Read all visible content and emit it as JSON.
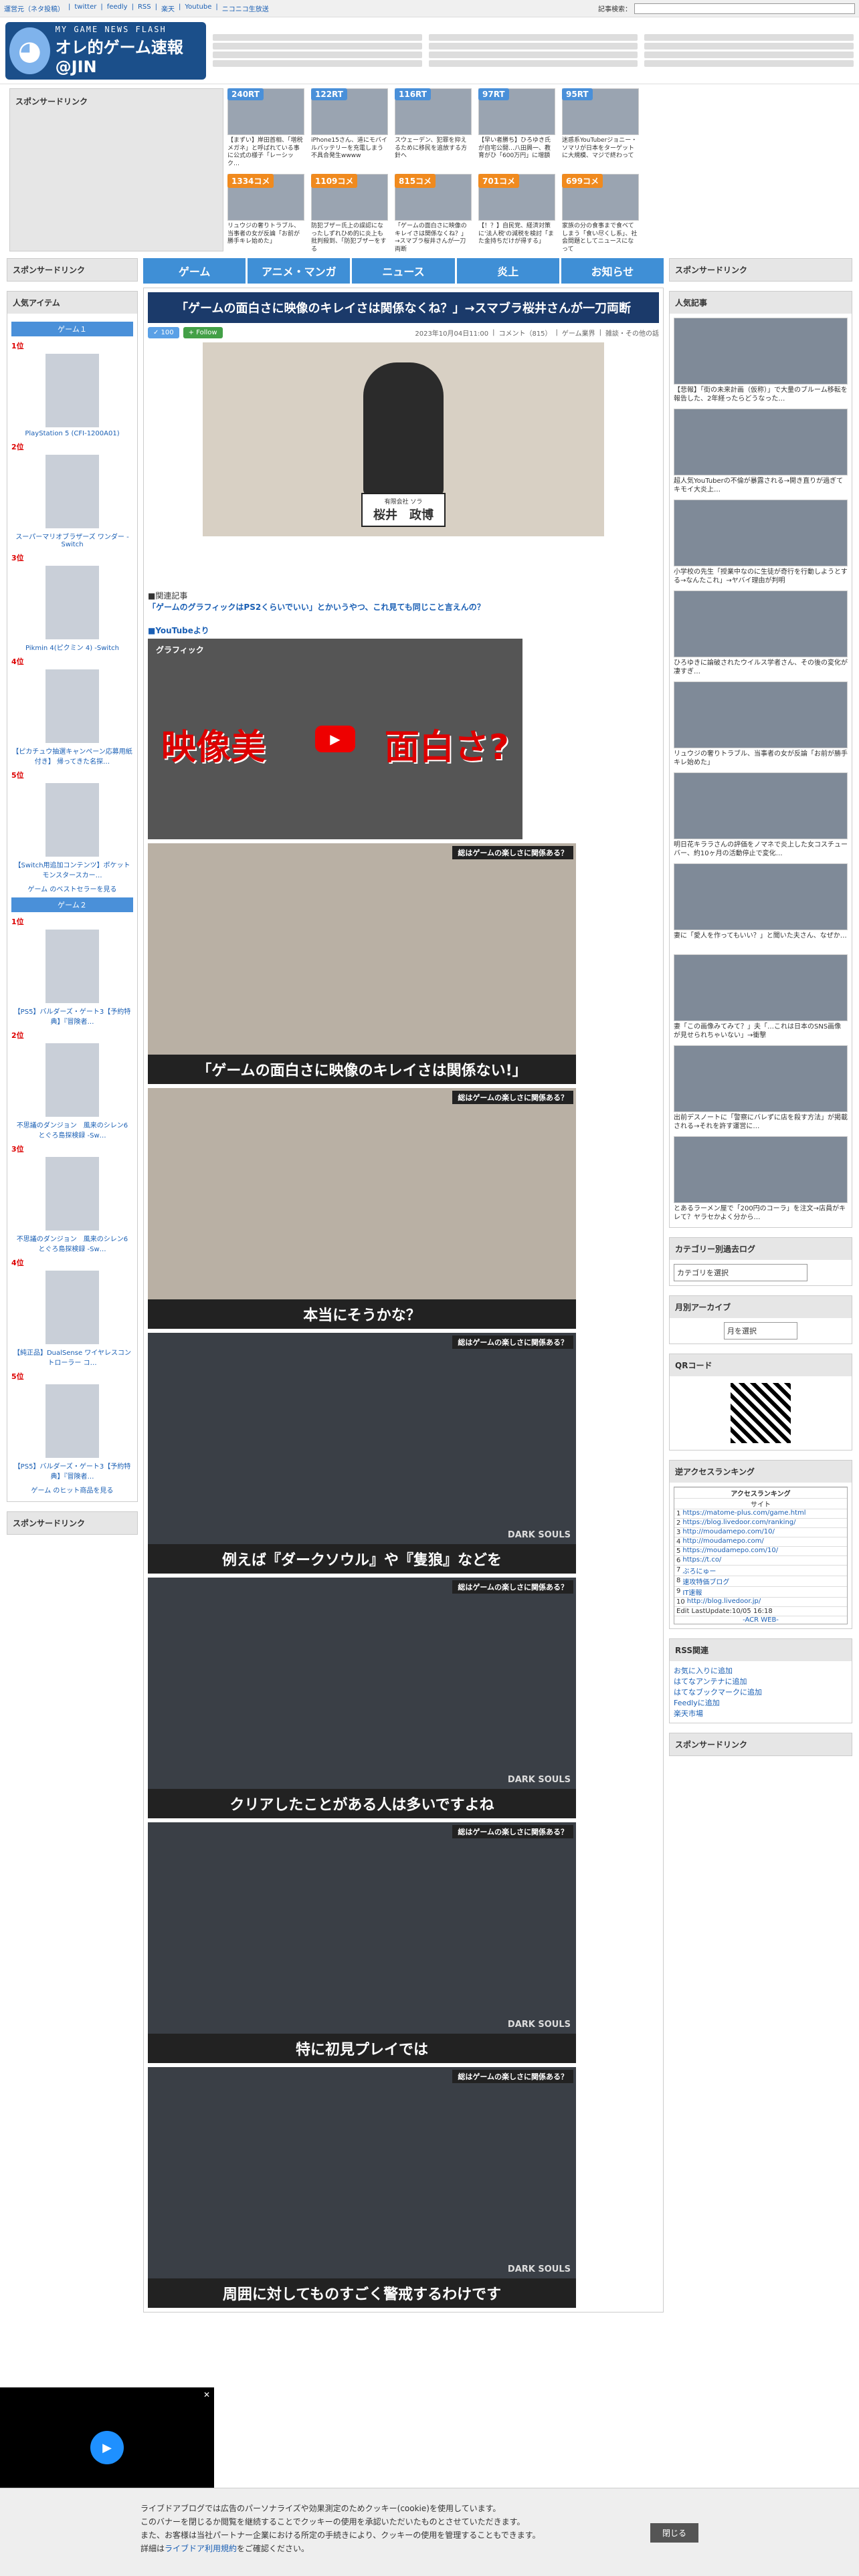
{
  "topbar": {
    "links": [
      "運営元（ネタ投稿）",
      "twitter",
      "feedly",
      "RSS",
      "楽天",
      "Youtube",
      "ニコニコ生放送"
    ],
    "search_label": "記事検索："
  },
  "logo": {
    "title_small": "MY GAME NEWS FLASH",
    "title_large": "オレ的ゲーム速報@JIN"
  },
  "sponsor_label": "スポンサードリンク",
  "top_thumbs_row1": [
    {
      "badge": "240RT",
      "caption": "【まずい】岸田首相、「増税メガネ」と呼ばれている事に公式の様子「レーシック…"
    },
    {
      "badge": "122RT",
      "caption": "iPhone15さん、道にモバイルバッテリーを充電しまう不具合発生wwww"
    },
    {
      "badge": "116RT",
      "caption": "スウェーデン、犯罪を抑えるために移民を追放する方針へ"
    },
    {
      "badge": "97RT",
      "caption": "【早い者勝ち】ひろゆき氏が自宅公開…八田興一、教育がひ「600万円」に増額"
    },
    {
      "badge": "95RT",
      "caption": "迷惑系YouTuberジョニー・ソマリが日本をターゲットに大規模、マジで終わって"
    }
  ],
  "top_thumbs_row2": [
    {
      "badge": "1334コメ",
      "caption": "リュウジの奢りトラブル、当事者の女が反論「お前が勝手キレ始めた」"
    },
    {
      "badge": "1109コメ",
      "caption": "防犯ブザー氏上の誤認になったしずれひめ的に炎上も批判殺到、「防犯ブザーをする"
    },
    {
      "badge": "815コメ",
      "caption": "「ゲームの面白さに映像のキレイさは関係なくね？」→スマブラ桜井さんが一刀両断"
    },
    {
      "badge": "701コメ",
      "caption": "【！？】自民党、経済対策に'法人税'の減税を検討「また金持ちだけが得する」"
    },
    {
      "badge": "699コメ",
      "caption": "家族の分の食事まで食べてしまう「食い尽くし系」、社会問題としてニュースになって"
    }
  ],
  "nav": [
    "ゲーム",
    "アニメ・マンガ",
    "ニュース",
    "炎上",
    "お知らせ"
  ],
  "left": {
    "popular_label": "人気アイテム",
    "game1_label": "ゲーム１",
    "game1_items": [
      {
        "rank": "1位",
        "title": "PlayStation 5 (CFI-1200A01)"
      },
      {
        "rank": "2位",
        "title": "スーパーマリオブラザーズ ワンダー -Switch"
      },
      {
        "rank": "3位",
        "title": "Pikmin 4(ピクミン 4) -Switch"
      },
      {
        "rank": "4位",
        "title": "【ピカチュウ抽選キャンペーン応募用紙付き】 帰ってきた名探…"
      },
      {
        "rank": "5位",
        "title": "【Switch用追加コンテンツ】ポケットモンスタースカー…"
      }
    ],
    "game1_more": "ゲーム のベストセラーを見る",
    "game2_label": "ゲーム２",
    "game2_items": [
      {
        "rank": "1位",
        "title": "【PS5】バルダーズ・ゲート3【予約特典】『冒険者…"
      },
      {
        "rank": "2位",
        "title": "不思議のダンジョン　風来のシレン6　とぐろ島探検録 -Sw…"
      },
      {
        "rank": "3位",
        "title": "不思議のダンジョン　風来のシレン6　とぐろ島探検録 -Sw…"
      },
      {
        "rank": "4位",
        "title": "【純正品】DualSense ワイヤレスコントローラー コ…"
      },
      {
        "rank": "5位",
        "title": "【PS5】バルダーズ・ゲート3【予約特典】『冒険者…"
      }
    ],
    "game2_more": "ゲーム のヒット商品を見る"
  },
  "article": {
    "title": "「ゲームの面白さに映像のキレイさは関係なくね？」→スマブラ桜井さんが一刀両断",
    "date": "2023年10月04日11:00",
    "comment": "コメント（815）",
    "category": "ゲーム業界",
    "category2": "雑談・その他の話",
    "name_card_small": "有限会社 ソラ",
    "name_card": "桜井　政博",
    "related_label": "■関連記事",
    "related_link": "「ゲームのグラフィックはPS2くらいでいい」とかいうやつ、これ見ても同じこと言えんの？",
    "yt_label": "■YouTubeより",
    "yt_title": "グラフィック",
    "yt_big_left": "映像美",
    "yt_big_right": "面白さ?",
    "slide_tag": "総はゲームの楽しさに関係ある？",
    "slides": [
      {
        "caption": "「ゲームの面白さに映像のキレイさは関係ない!」"
      },
      {
        "caption": "本当にそうかな？"
      },
      {
        "caption": "例えば『ダークソウル』や『隻狼』などを"
      },
      {
        "caption": "クリアしたことがある人は多いですよね"
      },
      {
        "caption": "特に初見プレイでは"
      },
      {
        "caption": "周囲に対してものすごく警戒するわけです"
      }
    ],
    "dark_souls_logo": "DARK SOULS"
  },
  "right": {
    "popular_articles": "人気記事",
    "articles": [
      "【悲報】「街の未来計画（仮称）」で大量のブルーム移転を報告した、2年経ったらどうなった…",
      "超人気YouTuberの不倫が暴露される→開き直りが過ぎてキモイ大炎上…",
      "小学校の先生「授業中なのに生徒が奇行を行動しようとする→なんたこれ」→ヤバイ理由が判明",
      "ひろゆきに論破されたウイルス学者さん、その後の変化が凄すぎ…",
      "リュウジの奢りトラブル、当事者の女が反論「お前が勝手キレ始めた」",
      "明日花キララさんの評価をノマネで炎上した女コスチューバー、約10ヶ月の活動停止で変化…",
      "妻に「愛人を作ってもいい？」と聞いた夫さん、なぜか…",
      "妻「この画像みてみて？」夫「…これは日本のSNS画像が見せられちゃいない」→衝撃",
      "出前デスノートに「警察にバレずに店を殺す方法」が掲載される→それを許す運営に…",
      "とあるラーメン屋で「200円のコーラ」を注文→店員がキレて？ヤラセかよく分から…"
    ],
    "category_label": "カテゴリー別過去ログ",
    "category_select": "カテゴリを選択",
    "archive_label": "月別アーカイブ",
    "archive_select": "月を選択",
    "qr_label": "QRコード",
    "access_label": "逆アクセスランキング",
    "access_header": "アクセスランキング",
    "access_subheader": "サイト",
    "access_rows": [
      {
        "n": "1",
        "site": "https://matome-plus.com/game.html"
      },
      {
        "n": "2",
        "site": "https://blog.livedoor.com/ranking/"
      },
      {
        "n": "3",
        "site": "http://moudamepo.com/10/"
      },
      {
        "n": "4",
        "site": "http://moudamepo.com/"
      },
      {
        "n": "5",
        "site": "https://moudamepo.com/10/"
      },
      {
        "n": "6",
        "site": "https://t.co/"
      },
      {
        "n": "7",
        "site": "ぶろにゅー"
      },
      {
        "n": "8",
        "site": "速攻特価ブログ"
      },
      {
        "n": "9",
        "site": "IT速報"
      },
      {
        "n": "10",
        "site": "http://blog.livedoor.jp/"
      }
    ],
    "access_footer": "Edit LastUpdate:10/05 16:18",
    "access_credit": "-ACR WEB-",
    "rss_label": "RSS関連",
    "rss_links": [
      "お気に入りに追加",
      "はてなアンテナに追加",
      "はてなブックマークに追加",
      "Feedlyに追加",
      "楽天市場"
    ]
  },
  "cookie": {
    "line1": "ライブドアブログでは広告のパーソナライズや効果測定のためクッキー(cookie)を使用しています。",
    "line2": "このバナーを閉じるか閲覧を継続することでクッキーの使用を承認いただいたものとさせていただきます。",
    "line3": "また、お客様は当社パートナー企業における所定の手続きにより、クッキーの使用を管理することもできます。",
    "line4_prefix": "詳細は",
    "line4_link": "ライブドア利用規約",
    "line4_suffix": "をご確認ください。",
    "close": "閉じる"
  }
}
